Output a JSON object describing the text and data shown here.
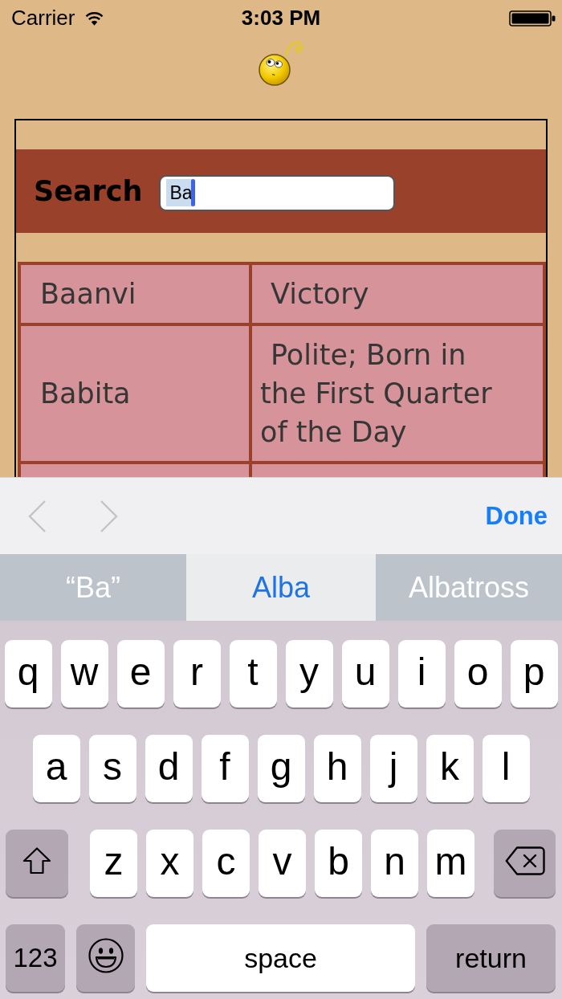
{
  "status_bar": {
    "carrier": "Carrier",
    "time": "3:03 PM"
  },
  "search": {
    "label": "Search",
    "value": "Ba",
    "focused": true
  },
  "table": {
    "rows": [
      [
        "Baanvi",
        "Victory"
      ],
      [
        "Babita",
        "Polite; Born in the First Quarter of the Day"
      ]
    ]
  },
  "keyboard_toolbar": {
    "previous": {
      "disabled": true
    },
    "next": {
      "disabled": true
    },
    "done": "Done"
  },
  "suggestions": [
    {
      "label": "“Ba”",
      "selected": false
    },
    {
      "label": "Alba",
      "selected": true
    },
    {
      "label": "Albatross",
      "selected": false
    }
  ],
  "keyboard": {
    "key_rows": [
      {
        "keys": [
          {
            "kind": "letter",
            "label": "q"
          },
          {
            "kind": "letter",
            "label": "w"
          },
          {
            "kind": "letter",
            "label": "e"
          },
          {
            "kind": "letter",
            "label": "r"
          },
          {
            "kind": "letter",
            "label": "t"
          },
          {
            "kind": "letter",
            "label": "y"
          },
          {
            "kind": "letter",
            "label": "u"
          },
          {
            "kind": "letter",
            "label": "i"
          },
          {
            "kind": "letter",
            "label": "o"
          },
          {
            "kind": "letter",
            "label": "p"
          }
        ]
      },
      {
        "keys": [
          {
            "kind": "letter",
            "label": "a"
          },
          {
            "kind": "letter",
            "label": "s"
          },
          {
            "kind": "letter",
            "label": "d"
          },
          {
            "kind": "letter",
            "label": "f"
          },
          {
            "kind": "letter",
            "label": "g"
          },
          {
            "kind": "letter",
            "label": "h"
          },
          {
            "kind": "letter",
            "label": "j"
          },
          {
            "kind": "letter",
            "label": "k"
          },
          {
            "kind": "letter",
            "label": "l"
          }
        ]
      },
      {
        "keys": [
          {
            "kind": "shift"
          },
          {
            "kind": "letter",
            "label": "z"
          },
          {
            "kind": "letter",
            "label": "x"
          },
          {
            "kind": "letter",
            "label": "c"
          },
          {
            "kind": "letter",
            "label": "v"
          },
          {
            "kind": "letter",
            "label": "b"
          },
          {
            "kind": "letter",
            "label": "n"
          },
          {
            "kind": "letter",
            "label": "m"
          },
          {
            "kind": "delete"
          }
        ]
      },
      {
        "keys": [
          {
            "kind": "numbers",
            "label": "123"
          },
          {
            "kind": "emoji"
          },
          {
            "kind": "space",
            "label": "space"
          },
          {
            "kind": "return",
            "label": "return"
          }
        ]
      }
    ]
  }
}
